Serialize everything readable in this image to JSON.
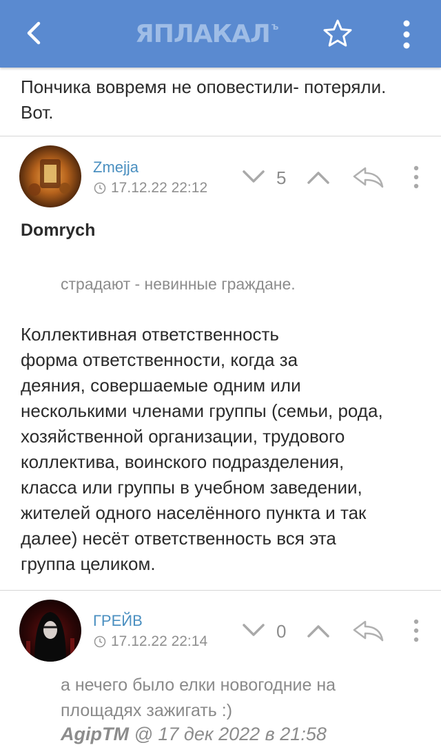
{
  "app": {
    "logo_text": "ЯПЛАКАЛ",
    "logo_sup": "ъ"
  },
  "icons": {
    "back": "chevron-left-icon",
    "favorite": "star-outline-icon",
    "menu": "more-vertical-icon",
    "downvote": "chevron-down-icon",
    "upvote": "chevron-up-icon",
    "reply": "reply-arrow-icon",
    "time": "clock-icon"
  },
  "colors": {
    "header_bg": "#5a8ad0",
    "logo": "#9fbde6",
    "username": "#4a8fc0",
    "muted": "#8c8c8c"
  },
  "previous_comment": {
    "lines": [
      "Пончика вовремя не оповестили- потеряли.",
      "Вот."
    ]
  },
  "comments": [
    {
      "username": "Zmejja",
      "timestamp": "17.12.22 22:12",
      "score": "5",
      "quote_author": "Domrych",
      "quote_text": "страдают - невинные граждане.",
      "body_lines": [
        "Коллективная ответственность",
        "форма ответственности, когда за",
        "деяния, совершаемые одним или",
        "несколькими членами группы (семьи, рода,",
        "хозяйственной организации, трудового",
        "коллектива, воинского подразделения,",
        "класса или группы в учебном заведении,",
        "жителей одного населённого пункта и так",
        "далее) несёт ответственность вся эта",
        "группа целиком."
      ]
    },
    {
      "username": "ГРЕЙВ",
      "timestamp": "17.12.22 22:14",
      "score": "0",
      "quote_lines": [
        "а нечего было елки новогодние на",
        "площадях зажигать :)"
      ],
      "quote_sig_author": "AgipTM",
      "quote_sig_rest": " @ 17 дек 2022 в 21:58"
    }
  ]
}
